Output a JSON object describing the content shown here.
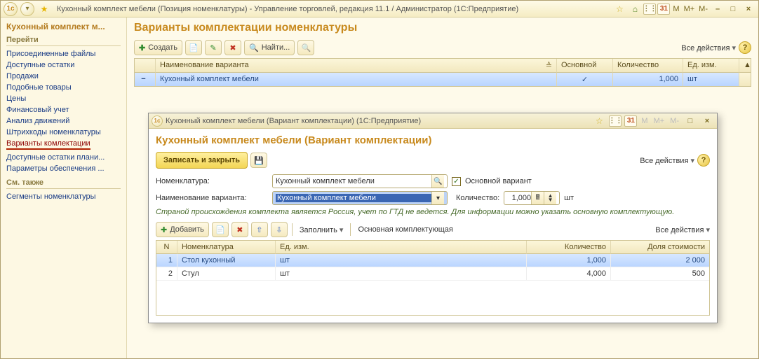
{
  "titlebar": {
    "title": "Кухонный комплект мебели (Позиция номенклатуры) - Управление торговлей, редакция 11.1 / Администратор  (1С:Предприятие)",
    "mem": [
      "M",
      "M+",
      "M-"
    ],
    "window_buttons": [
      "–",
      "□",
      "×"
    ]
  },
  "sidebar": {
    "title": "Кухонный комплект м...",
    "group1_title": "Перейти",
    "links": [
      "Присоединенные файлы",
      "Доступные остатки",
      "Продажи",
      "Подобные товары",
      "Цены",
      "Финансовый учет",
      "Анализ движений",
      "Штрихкоды номенклатуры",
      "Варианты комлектации",
      "Доступные остатки плани...",
      "Параметры обеспечения ..."
    ],
    "group2_title": "См. также",
    "links2": [
      "Сегменты номенклатуры"
    ]
  },
  "page": {
    "title": "Варианты комплектации номенклатуры",
    "toolbar": {
      "create": "Создать",
      "find": "Найти..."
    },
    "all_actions": "Все действия",
    "grid": {
      "col_name": "Наименование варианта",
      "col_main": "Основной",
      "col_qty": "Количество",
      "col_unit": "Ед. изм.",
      "row": {
        "name": "Кухонный комплект мебели",
        "main": "✓",
        "qty": "1,000",
        "unit": "шт"
      }
    }
  },
  "inner": {
    "titlebar": "Кухонный комплект мебели (Вариант комплектации)  (1С:Предприятие)",
    "heading": "Кухонный комплект мебели (Вариант комплектации)",
    "save_close": "Записать и закрыть",
    "all_actions": "Все действия",
    "form": {
      "lbl_nomen": "Номенклатура:",
      "val_nomen": "Кухонный комплект мебели",
      "chk_main": "Основной вариант",
      "lbl_variant": "Наименование варианта:",
      "val_variant": "Кухонный комплект мебели",
      "lbl_qty": "Количество:",
      "val_qty": "1,000",
      "unit": "шт"
    },
    "hint": "Страной происхождения комплекта является Россия, учет по ГТД не ведется. Для информации можно указать основную комплектующую.",
    "toolbar2": {
      "add": "Добавить",
      "fill": "Заполнить",
      "main_comp": "Основная комплектующая"
    },
    "grid": {
      "col_n": "N",
      "col_nomen": "Номенклатура",
      "col_unit": "Ед. изм.",
      "col_qty": "Количество",
      "col_share": "Доля стоимости",
      "rows": [
        {
          "n": "1",
          "nomen": "Стол кухонный",
          "unit": "шт",
          "qty": "1,000",
          "share": "2 000"
        },
        {
          "n": "2",
          "nomen": "Стул",
          "unit": "шт",
          "qty": "4,000",
          "share": "500"
        }
      ]
    }
  }
}
